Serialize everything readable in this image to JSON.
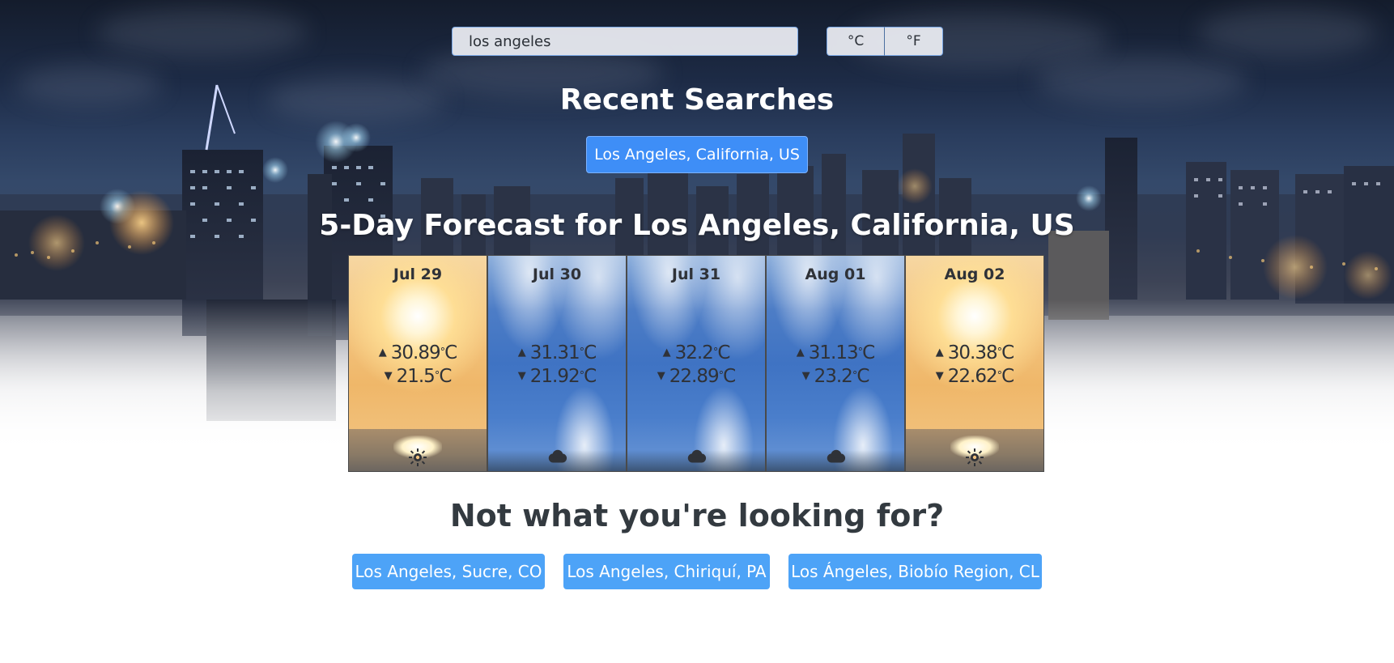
{
  "search": {
    "value": "los angeles"
  },
  "units": {
    "celsius_label": "°C",
    "fahrenheit_label": "°F"
  },
  "recent": {
    "title": "Recent Searches",
    "items": [
      "Los Angeles, California, US"
    ]
  },
  "forecast": {
    "title": "5-Day Forecast for Los Angeles, California, US",
    "unit": "C",
    "days": [
      {
        "date": "Jul 29",
        "high": "30.89",
        "low": "21.5",
        "condition": "sunny",
        "icon": "sun-icon"
      },
      {
        "date": "Jul 30",
        "high": "31.31",
        "low": "21.92",
        "condition": "cloudy",
        "icon": "cloud-icon"
      },
      {
        "date": "Jul 31",
        "high": "32.2",
        "low": "22.89",
        "condition": "cloudy",
        "icon": "cloud-icon"
      },
      {
        "date": "Aug 01",
        "high": "31.13",
        "low": "23.2",
        "condition": "cloudy",
        "icon": "cloud-icon"
      },
      {
        "date": "Aug 02",
        "high": "30.38",
        "low": "22.62",
        "condition": "sunny",
        "icon": "sun-icon"
      }
    ]
  },
  "alternatives": {
    "title": "Not what you're looking for?",
    "items": [
      "Los Angeles, Sucre, CO",
      "Los Angeles, Chiriquí, PA",
      "Los Ángeles, Biobío Region, CL"
    ]
  },
  "colors": {
    "accent": "#4da3f7",
    "recent_chip": "#3e8ef7",
    "text_dark": "#333a40"
  }
}
